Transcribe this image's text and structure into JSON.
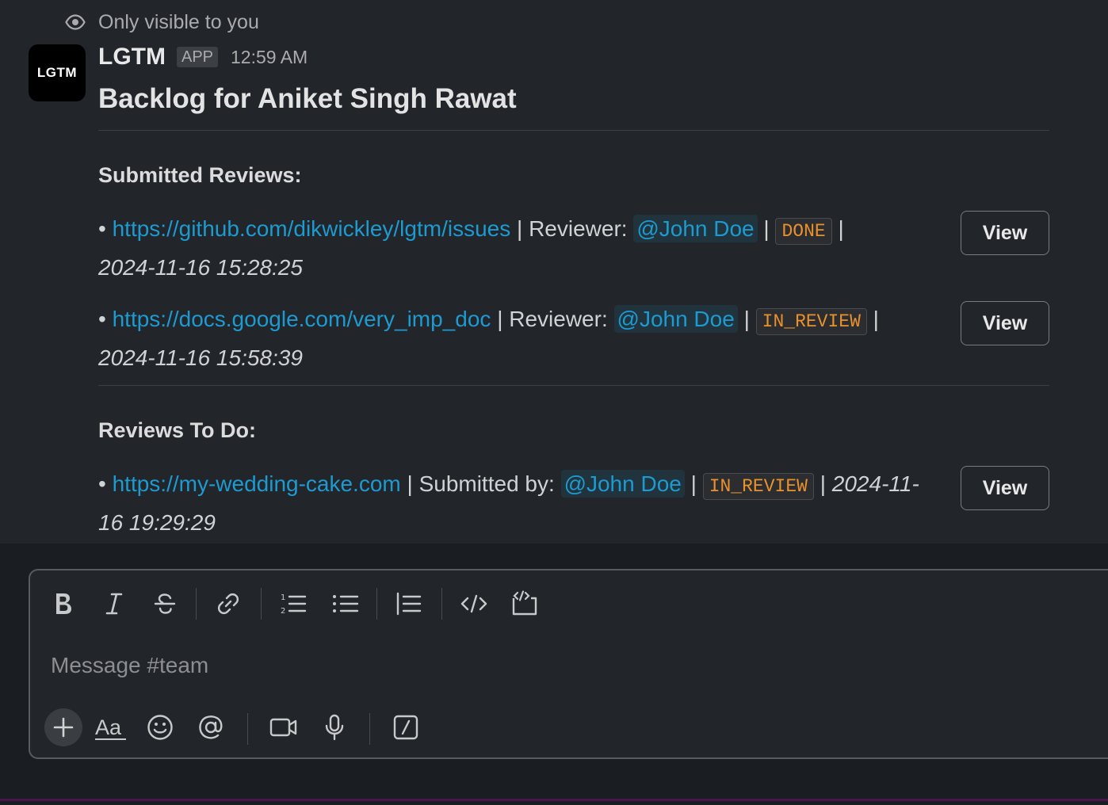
{
  "message": {
    "ephemeral_label": "Only visible to you",
    "avatar_text": "LGTM",
    "sender": "LGTM",
    "badge": "APP",
    "time": "12:59 AM",
    "title": "Backlog for Aniket Singh Rawat"
  },
  "sections": {
    "submitted": {
      "title": "Submitted Reviews:",
      "items": [
        {
          "bullet": "•",
          "link": "https://github.com/dikwickley/lgtm/issues",
          "role_label": "| Reviewer:",
          "mention": "@John Doe",
          "sep1": "|",
          "status": "DONE",
          "sep2": "|",
          "date": "2024-11-16 15:28:25",
          "button": "View"
        },
        {
          "bullet": "•",
          "link": "https://docs.google.com/very_imp_doc",
          "role_label": "| Reviewer:",
          "mention": "@John Doe",
          "sep1": "|",
          "status": "IN_REVIEW",
          "sep2": "|",
          "date": "2024-11-16 15:58:39",
          "button": "View"
        }
      ]
    },
    "todo": {
      "title": "Reviews To Do:",
      "items": [
        {
          "bullet": "•",
          "link": "https://my-wedding-cake.com",
          "role_label": "| Submitted by:",
          "mention": "@John Doe",
          "sep1": "|",
          "status": "IN_REVIEW",
          "sep2": "|",
          "date": "2024-11-16 19:29:29",
          "button": "View"
        }
      ]
    }
  },
  "composer": {
    "placeholder": "Message #team",
    "format_tools": [
      "bold-icon",
      "italic-icon",
      "strikethrough-icon",
      "link-icon",
      "numbered-list-icon",
      "bulleted-list-icon",
      "blockquote-icon",
      "code-icon",
      "code-block-icon"
    ],
    "action_tools": [
      "plus-icon",
      "text-formatting-icon",
      "emoji-icon",
      "mention-icon",
      "video-icon",
      "microphone-icon",
      "shortcuts-icon"
    ]
  },
  "colors": {
    "background": "#1a1d21",
    "message_background": "#222529",
    "link": "#1d9bd1",
    "status_text": "#e8912d"
  }
}
